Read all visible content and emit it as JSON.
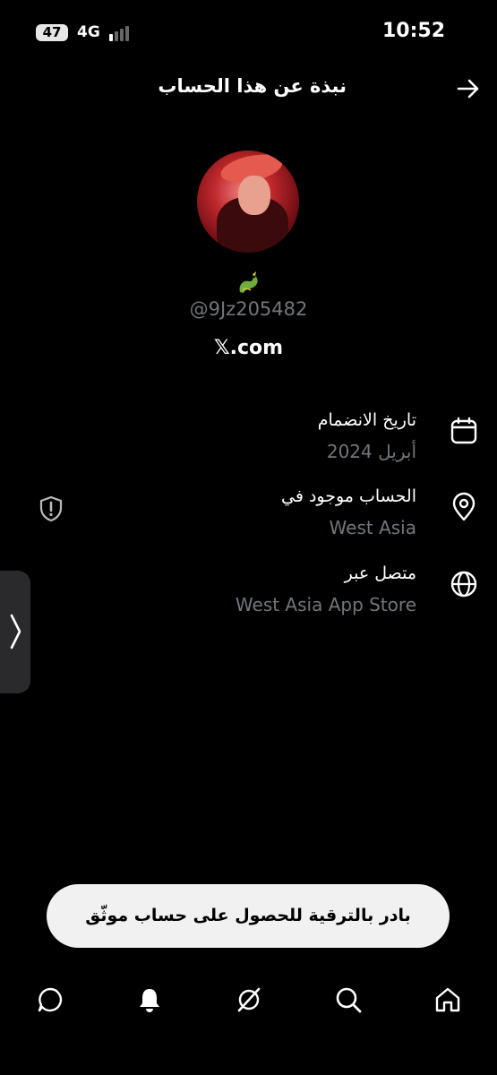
{
  "status_bar": {
    "battery": "47",
    "network": "4G",
    "time": "10:52"
  },
  "header": {
    "title": "نبذة عن هذا الحساب",
    "back_icon": "arrow-right-icon"
  },
  "profile": {
    "handle": "@9Jz205482",
    "website": "𝕏.com",
    "badge_icon": "dragon-emoji-icon"
  },
  "info": [
    {
      "label": "تاريخ الانضمام",
      "value": "أبريل 2024",
      "icon": "calendar-icon"
    },
    {
      "label": "الحساب موجود في",
      "value": "West Asia",
      "icon": "location-pin-icon"
    },
    {
      "label": "متصل عبر",
      "value": "West Asia App Store",
      "icon": "globe-icon"
    }
  ],
  "upgrade": {
    "label": "بادر بالترقية للحصول على حساب موثّق"
  },
  "nav": [
    "chat-icon",
    "bell-icon",
    "grok-icon",
    "search-icon",
    "home-icon"
  ]
}
